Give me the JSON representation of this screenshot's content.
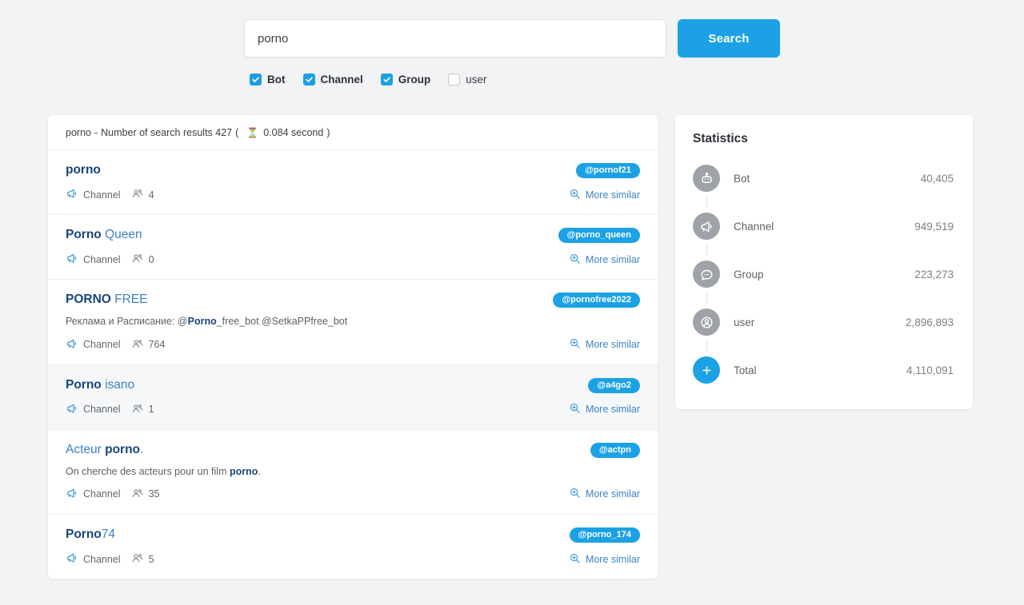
{
  "search": {
    "value": "porno",
    "placeholder": "Search",
    "button_label": "Search",
    "search_icon": "search-icon"
  },
  "filters": [
    {
      "label": "Bot",
      "checked": true
    },
    {
      "label": "Channel",
      "checked": true
    },
    {
      "label": "Group",
      "checked": true
    },
    {
      "label": "user",
      "checked": false
    }
  ],
  "results": {
    "header": {
      "query": "porno",
      "separator": "-",
      "count_text": "Number of search results 427",
      "count": 427,
      "open_paren": "(",
      "hourglass_icon": "hourglass-icon",
      "time_text": "0.084 second",
      "close_paren": ")"
    },
    "items": [
      {
        "title_bold": "porno",
        "title_rest": "",
        "badge": "@pornof21",
        "description": "",
        "type_icon": "megaphone-icon",
        "type": "Channel",
        "members_icon": "members-icon",
        "members": "4",
        "more_icon": "zoom-in-icon",
        "more_label": "More similar",
        "highlighted": false
      },
      {
        "title_bold": "Porno",
        "title_rest": " Queen",
        "badge": "@porno_queen",
        "description": "",
        "type_icon": "megaphone-icon",
        "type": "Channel",
        "members_icon": "members-icon",
        "members": "0",
        "more_icon": "zoom-in-icon",
        "more_label": "More similar",
        "highlighted": false
      },
      {
        "title_bold": "PORNO",
        "title_rest": " FREE",
        "badge": "@pornofree2022",
        "description_pre": "Реклама и Расписание: @",
        "description_bold": "Porno",
        "description_post": "_free_bot @SetkaPPfree_bot",
        "type_icon": "megaphone-icon",
        "type": "Channel",
        "members_icon": "members-icon",
        "members": "764",
        "more_icon": "zoom-in-icon",
        "more_label": "More similar",
        "highlighted": false
      },
      {
        "title_bold": "Porno",
        "title_rest": " isano",
        "badge": "@a4go2",
        "description": "",
        "type_icon": "megaphone-icon",
        "type": "Channel",
        "members_icon": "members-icon",
        "members": "1",
        "more_icon": "zoom-in-icon",
        "more_label": "More similar",
        "highlighted": true
      },
      {
        "title_pre": "Acteur ",
        "title_bold": "porno",
        "title_rest": ".",
        "badge": "@actpn",
        "description_pre": "On cherche des acteurs pour un film ",
        "description_bold": "porno",
        "description_post": ".",
        "type_icon": "megaphone-icon",
        "type": "Channel",
        "members_icon": "members-icon",
        "members": "35",
        "more_icon": "zoom-in-icon",
        "more_label": "More similar",
        "highlighted": false
      },
      {
        "title_bold": "Porno",
        "title_rest": "74",
        "badge": "@porno_174",
        "description": "",
        "type_icon": "megaphone-icon",
        "type": "Channel",
        "members_icon": "members-icon",
        "members": "5",
        "more_icon": "zoom-in-icon",
        "more_label": "More similar",
        "highlighted": false
      }
    ]
  },
  "statistics": {
    "title": "Statistics",
    "rows": [
      {
        "icon": "robot-icon",
        "label": "Bot",
        "value": "40,405"
      },
      {
        "icon": "megaphone-icon",
        "label": "Channel",
        "value": "949,519"
      },
      {
        "icon": "chat-icon",
        "label": "Group",
        "value": "223,273"
      },
      {
        "icon": "user-icon",
        "label": "user",
        "value": "2,896,893"
      },
      {
        "icon": "plus-icon",
        "label": "Total",
        "value": "4,110,091"
      }
    ]
  },
  "colors": {
    "accent": "#1ca2e4",
    "page_bg": "#f2f3f5",
    "title_bold": "#17457c",
    "title_link": "#3c82c4",
    "stat_icon_bg": "#9da3a9"
  }
}
